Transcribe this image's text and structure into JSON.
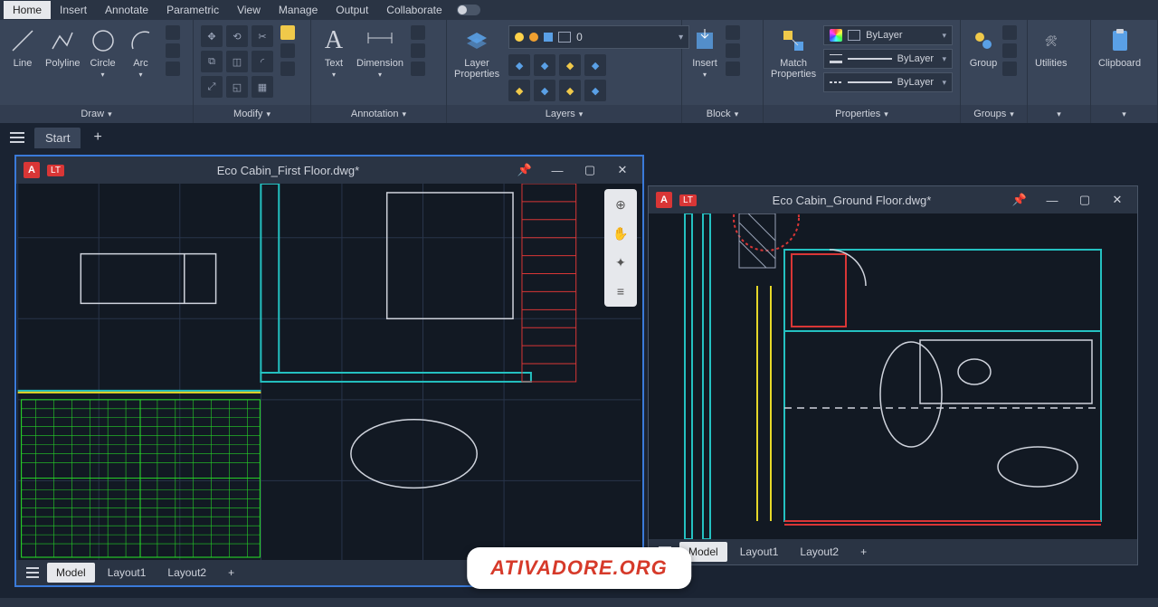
{
  "menu": {
    "items": [
      "Home",
      "Insert",
      "Annotate",
      "Parametric",
      "View",
      "Manage",
      "Output",
      "Collaborate"
    ],
    "active": 0
  },
  "ribbon": {
    "draw": {
      "caption": "Draw",
      "items": [
        "Line",
        "Polyline",
        "Circle",
        "Arc"
      ]
    },
    "modify": {
      "caption": "Modify"
    },
    "annotation": {
      "caption": "Annotation",
      "items": [
        "Text",
        "Dimension"
      ]
    },
    "layers": {
      "caption": "Layers",
      "lp": "Layer\nProperties",
      "current": "0"
    },
    "block": {
      "caption": "Block",
      "insert": "Insert"
    },
    "properties": {
      "caption": "Properties",
      "match": "Match\nProperties",
      "bylayer": "ByLayer"
    },
    "groups": {
      "caption": "Groups",
      "group": "Group"
    },
    "utilities": {
      "caption": "Utilities"
    },
    "clipboard": {
      "caption": "Clipboard"
    }
  },
  "docbar": {
    "start": "Start"
  },
  "window1": {
    "title": "Eco Cabin_First Floor.dwg*",
    "layouts": [
      "Model",
      "Layout1",
      "Layout2"
    ]
  },
  "window2": {
    "title": "Eco Cabin_Ground Floor.dwg*",
    "layouts": [
      "Model",
      "Layout1",
      "Layout2"
    ]
  },
  "watermark": "ATIVADORE.ORG",
  "colors": {
    "accent": "#3a7ad9",
    "red": "#d93636",
    "cyan": "#24c1c1",
    "green": "#29e629",
    "yellow": "#e6d829"
  }
}
